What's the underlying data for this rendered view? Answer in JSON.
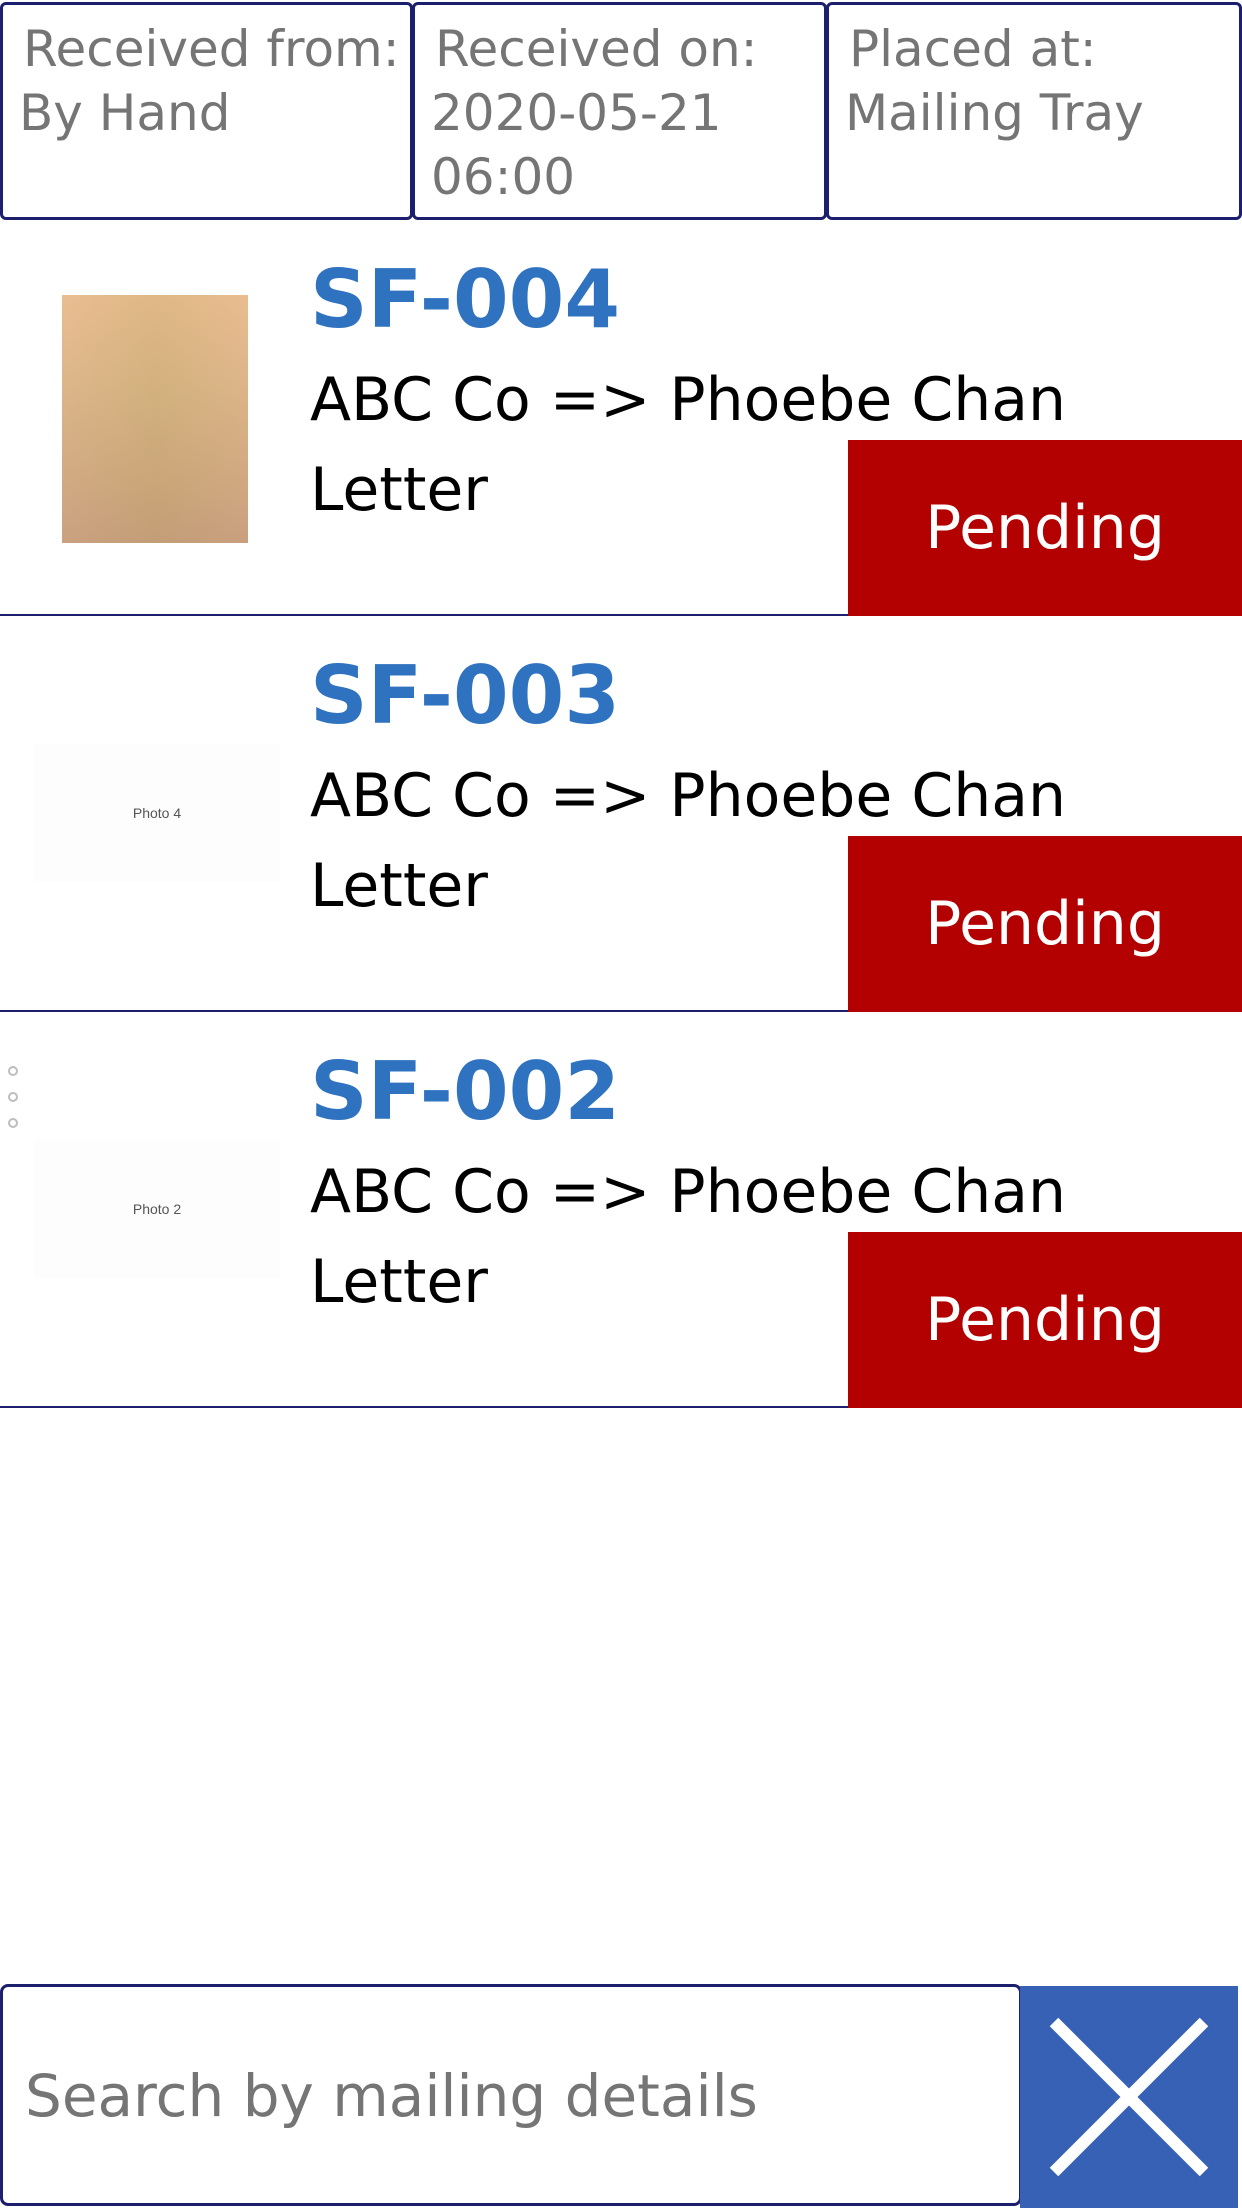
{
  "header": {
    "received_from_label": "Received from:",
    "received_from_value": "By Hand",
    "received_on_label": "Received on:",
    "received_on_value": "2020-05-21 06:00",
    "placed_at_label": "Placed at:",
    "placed_at_value": "Mailing Tray"
  },
  "items": [
    {
      "id": "SF-004",
      "route": "ABC Co => Phoebe Chan",
      "type": "Letter",
      "status": "Pending",
      "photo_label": ""
    },
    {
      "id": "SF-003",
      "route": "ABC Co => Phoebe Chan",
      "type": "Letter",
      "status": "Pending",
      "photo_label": "Photo 4"
    },
    {
      "id": "SF-002",
      "route": "ABC Co => Phoebe Chan",
      "type": "Letter",
      "status": "Pending",
      "photo_label": "Photo 2"
    }
  ],
  "search": {
    "placeholder": "Search by mailing details",
    "value": ""
  },
  "icons": {
    "clear": "close-icon"
  },
  "colors": {
    "accent_blue": "#2f72c0",
    "status_pending": "#b30000",
    "border_navy": "#1b1f6e",
    "clear_button": "#3761b5"
  }
}
